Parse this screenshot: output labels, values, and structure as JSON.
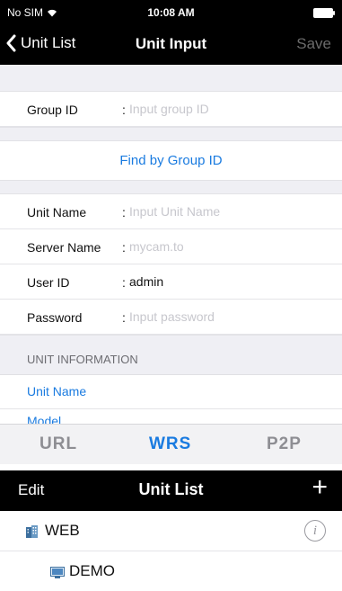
{
  "status_bar": {
    "carrier": "No SIM",
    "time": "10:08 AM"
  },
  "nav": {
    "back_label": "Unit List",
    "title": "Unit Input",
    "save_label": "Save"
  },
  "group": {
    "label": "Group ID",
    "colon": ":",
    "placeholder": "Input group ID"
  },
  "find_button": "Find by Group ID",
  "fields": {
    "unit_name": {
      "label": "Unit Name",
      "colon": ":",
      "placeholder": "Input Unit Name",
      "value": ""
    },
    "server_name": {
      "label": "Server Name",
      "colon": ":",
      "placeholder": "mycam.to",
      "value": ""
    },
    "user_id": {
      "label": "User ID",
      "colon": ":",
      "placeholder": "",
      "value": "admin"
    },
    "password": {
      "label": "Password",
      "colon": ":",
      "placeholder": "Input password",
      "value": ""
    }
  },
  "unit_information": {
    "header": "UNIT INFORMATION",
    "items": [
      "Unit Name",
      "Model"
    ]
  },
  "tabs": [
    {
      "label": "URL",
      "selected": false
    },
    {
      "label": "WRS",
      "selected": true
    },
    {
      "label": "P2P",
      "selected": false
    }
  ],
  "unit_list": {
    "edit_label": "Edit",
    "title": "Unit List",
    "add_label": "+",
    "items": [
      {
        "name": "WEB",
        "icon": "building-icon",
        "info_label": "i"
      },
      {
        "name": "DEMO",
        "icon": "monitor-icon"
      }
    ]
  },
  "colors": {
    "accent": "#1a7be0",
    "nav_background": "#000000",
    "placeholder": "#c7c7cd",
    "section_background": "#efeff4"
  }
}
